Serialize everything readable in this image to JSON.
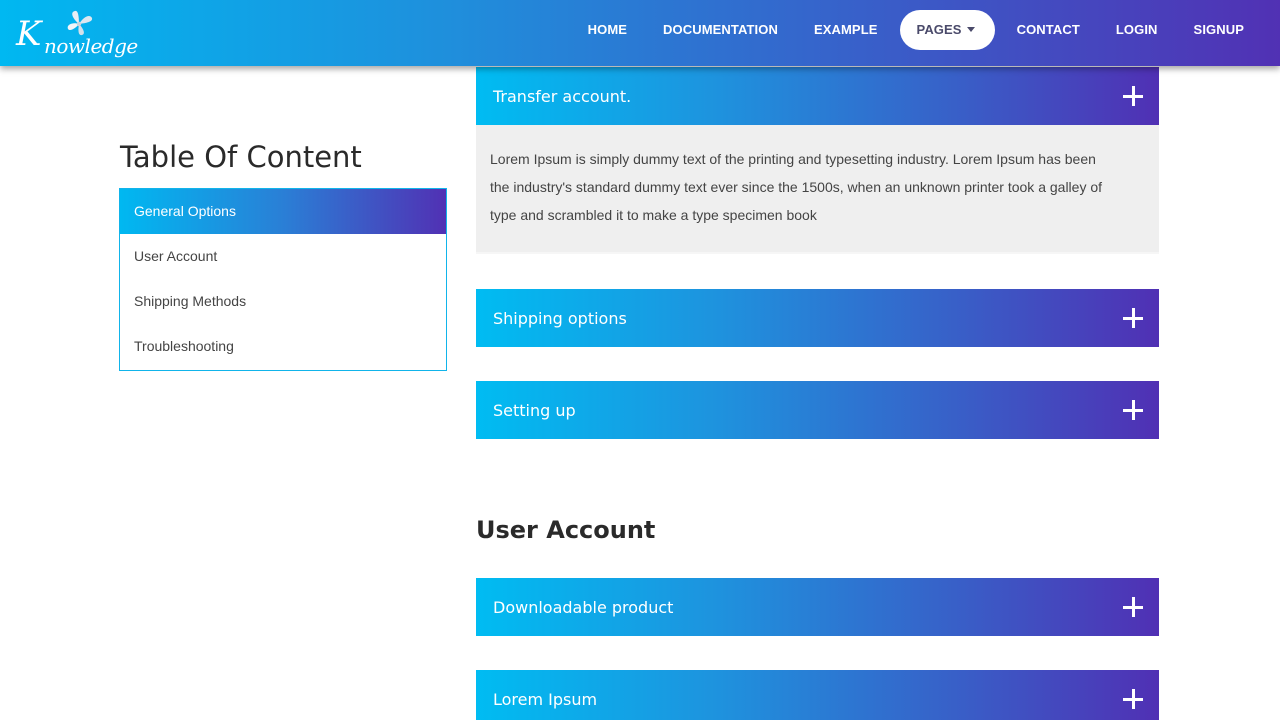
{
  "brand": {
    "logo_text_first": "K",
    "logo_text_rest": "nowledge"
  },
  "nav": {
    "items": [
      "HOME",
      "DOCUMENTATION",
      "EXAMPLE",
      "PAGES",
      "CONTACT",
      "LOGIN",
      "SIGNUP"
    ],
    "active": "PAGES"
  },
  "toc": {
    "title": "Table Of Content",
    "items": [
      "General Options",
      "User Account",
      "Shipping Methods",
      "Troubleshooting"
    ]
  },
  "accordions": {
    "transfer": {
      "title": "Transfer account.",
      "body": "Lorem Ipsum is simply dummy text of the printing and typesetting industry. Lorem Ipsum has been the industry's standard dummy text ever since the 1500s, when an unknown printer took a galley of type and scrambled it to make a type specimen book"
    },
    "shipping": {
      "title": "Shipping options"
    },
    "setting": {
      "title": "Setting up"
    },
    "downloadable": {
      "title": "Downloadable product"
    },
    "lorem": {
      "title": "Lorem Ipsum"
    }
  },
  "sections": {
    "user_account": "User Account"
  },
  "icons": {
    "expand": "plus-icon",
    "dropdown": "caret-down-icon",
    "logo": "flower-logo-icon"
  },
  "colors": {
    "gradient_start": "#00b8f1",
    "gradient_end": "#5131b4",
    "toc_border": "#11b4ea",
    "body_bg": "#efefef"
  }
}
